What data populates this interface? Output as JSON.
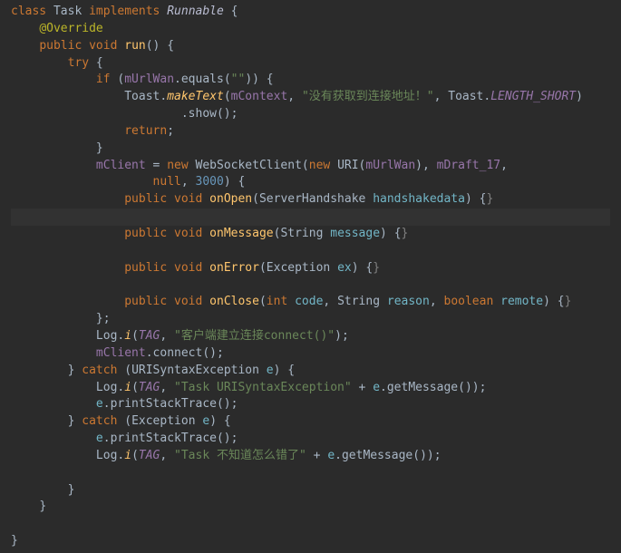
{
  "code": {
    "l1": {
      "classKw": "class",
      "className": "Task",
      "implementsKw": "implements",
      "interfaceName": "Runnable",
      "brace": " {"
    },
    "l2": {
      "annotation": "@Override"
    },
    "l3": {
      "pub": "public",
      "void": "void",
      "method": "run",
      "rest": "() {"
    },
    "l4": {
      "tryKw": "try",
      "rest": " {"
    },
    "l5": {
      "ifKw": "if",
      "open": " (",
      "field": "mUrlWan",
      "dot": ".",
      "call": "equals",
      "paren": "(",
      "str": "\"\"",
      "close": ")) {"
    },
    "l6": {
      "cls": "Toast",
      "dot1": ".",
      "m1": "makeText",
      "p1": "(",
      "a1": "mContext",
      "c1": ", ",
      "str": "\"没有获取到连接地址！\"",
      "c2": ", ",
      "cls2": "Toast",
      "dot2": ".",
      "const": "LENGTH_SHORT",
      "close": ")"
    },
    "l7": {
      "dot": ".",
      "show": "show",
      "rest": "();"
    },
    "l8": {
      "ret": "return",
      "semi": ";"
    },
    "l9": {
      "brace": "}"
    },
    "l10": {
      "field": "mClient",
      "eq": " = ",
      "newKw": "new",
      "sp": " ",
      "cls": "WebSocketClient",
      "p": "(",
      "newKw2": "new",
      "sp2": " ",
      "cls2": "URI",
      "p2": "(",
      "field2": "mUrlWan",
      "close": "), ",
      "field3": "mDraft_17",
      "comma": ","
    },
    "l11": {
      "nullKw": "null",
      "c": ", ",
      "num": "3000",
      "close": ") {"
    },
    "l12": {
      "pub": "public",
      "void": "void",
      "method": "onOpen",
      "p": "(",
      "type": "ServerHandshake",
      "sp": " ",
      "pname": "handshakedata",
      "close": ") {",
      "fold": "}"
    },
    "l13": {
      "pub": "public",
      "void": "void",
      "method": "onMessage",
      "p": "(",
      "type": "String",
      "sp": " ",
      "pname": "message",
      "close": ") {",
      "fold": "}"
    },
    "l14": {
      "pub": "public",
      "void": "void",
      "method": "onError",
      "p": "(",
      "type": "Exception",
      "sp": " ",
      "pname": "ex",
      "close": ") {",
      "fold": "}"
    },
    "l15": {
      "pub": "public",
      "void": "void",
      "method": "onClose",
      "p": "(",
      "prim": "int",
      "sp": " ",
      "pname": "code",
      "c1": ", ",
      "type2": "String",
      "sp2": " ",
      "pname2": "reason",
      "c2": ", ",
      "prim2": "boolean",
      "sp3": " ",
      "pname3": "remote",
      "close": ") {",
      "fold": "}"
    },
    "l16": {
      "brace": "};"
    },
    "l17": {
      "cls": "Log",
      "dot": ".",
      "m": "i",
      "p": "(",
      "tag": "TAG",
      "c": ", ",
      "str": "\"客户端建立连接connect()\"",
      "close": ");"
    },
    "l18": {
      "field": "mClient",
      "dot": ".",
      "m": "connect",
      "rest": "();"
    },
    "l19": {
      "brace": "} ",
      "catchKw": "catch",
      "p": " (",
      "type": "URISyntaxException",
      "sp": " ",
      "pname": "e",
      "close": ") {"
    },
    "l20": {
      "cls": "Log",
      "dot": ".",
      "m": "i",
      "p": "(",
      "tag": "TAG",
      "c": ", ",
      "str": "\"Task URISyntaxException\"",
      "plus": " + ",
      "pname": "e",
      "dot2": ".",
      "m2": "getMessage",
      "close": "());"
    },
    "l21": {
      "pname": "e",
      "dot": ".",
      "m": "printStackTrace",
      "rest": "();"
    },
    "l22": {
      "brace": "} ",
      "catchKw": "catch",
      "p": " (",
      "type": "Exception",
      "sp": " ",
      "pname": "e",
      "close": ") {"
    },
    "l23": {
      "pname": "e",
      "dot": ".",
      "m": "printStackTrace",
      "rest": "();"
    },
    "l24": {
      "cls": "Log",
      "dot": ".",
      "m": "i",
      "p": "(",
      "tag": "TAG",
      "c": ", ",
      "str": "\"Task 不知道怎么错了\"",
      "plus": " + ",
      "pname": "e",
      "dot2": ".",
      "m2": "getMessage",
      "close": "());"
    },
    "l25": {
      "brace": "}"
    },
    "l26": {
      "brace": "}"
    },
    "l27": {
      "brace": "}"
    }
  }
}
